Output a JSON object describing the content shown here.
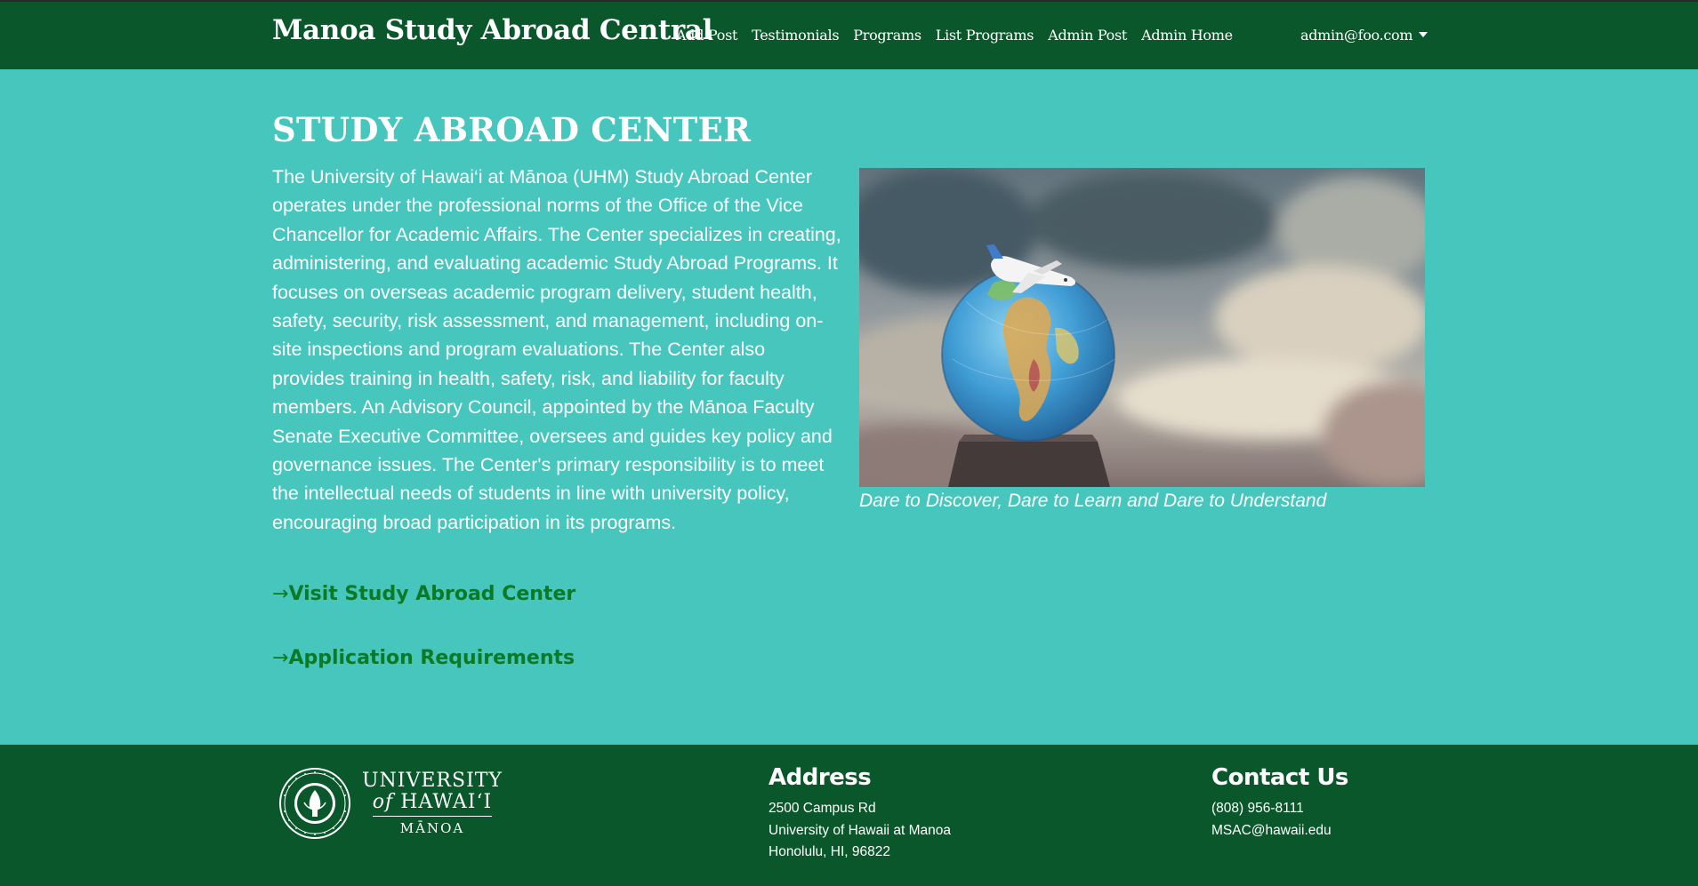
{
  "navbar": {
    "brand": "Manoa Study Abroad Central",
    "links": [
      "Add Post",
      "Testimonials",
      "Programs",
      "List Programs",
      "Admin Post",
      "Admin Home"
    ],
    "user_email": "admin@foo.com",
    "user_menu_icon": "caret-down-icon",
    "bg_color": "#09572a"
  },
  "main": {
    "title": "STUDY ABROAD CENTER",
    "description": "The University of Hawai‘i at Mānoa (UHM) Study Abroad Center operates under the professional norms of the Office of the Vice Chancellor for Academic Affairs. The Center specializes in creating, administering, and evaluating academic Study Abroad Programs. It focuses on overseas academic program delivery, student health, safety, security, risk assessment, and management, including on-site inspections and program evaluations. The Center also provides training in health, safety, risk, and liability for faculty members. An Advisory Council, appointed by the Mānoa Faculty Senate Executive Committee, oversees and guides key policy and governance issues. The Center's primary responsibility is to meet the intellectual needs of students in line with university policy, encouraging broad participation in its programs.",
    "image_caption": "Dare to Discover, Dare to Learn and Dare to Understand",
    "links": {
      "arrow": "→",
      "visit": "Visit Study Abroad Center",
      "requirements": "Application Requirements"
    },
    "bg_color": "#46c6bd",
    "link_color": "#0b7a25"
  },
  "footer": {
    "logo": {
      "line1": "UNIVERSITY",
      "line2_prefix": "of",
      "line2": "HAWAI‘I",
      "line3": "MĀNOA",
      "seal_text": "UNIVERSITY OF HAWAI‘I"
    },
    "address": {
      "heading": "Address",
      "lines": [
        "2500 Campus Rd",
        "University of Hawaii at Manoa",
        "Honolulu, HI, 96822"
      ]
    },
    "contact": {
      "heading": "Contact Us",
      "lines": [
        "(808) 956-8111",
        "MSAC@hawaii.edu"
      ]
    }
  }
}
